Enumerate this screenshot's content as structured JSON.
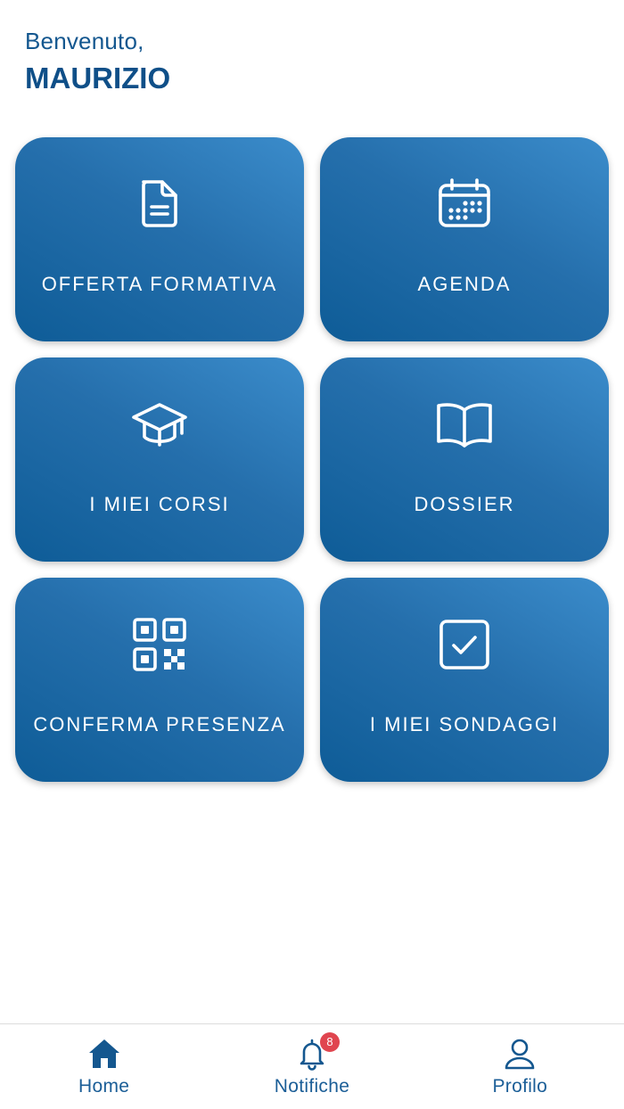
{
  "header": {
    "greeting": "Benvenuto,",
    "user_name": "MAURIZIO"
  },
  "tiles": [
    {
      "label": "OFFERTA FORMATIVA",
      "icon": "document-icon"
    },
    {
      "label": "AGENDA",
      "icon": "calendar-icon"
    },
    {
      "label": "I MIEI CORSI",
      "icon": "graduation-cap-icon"
    },
    {
      "label": "DOSSIER",
      "icon": "open-book-icon"
    },
    {
      "label": "CONFERMA PRESENZA",
      "icon": "qr-code-icon"
    },
    {
      "label": "I MIEI SONDAGGI",
      "icon": "checkbox-icon"
    }
  ],
  "tabbar": {
    "items": [
      {
        "label": "Home",
        "icon": "home-icon",
        "active": true
      },
      {
        "label": "Notifiche",
        "icon": "bell-icon",
        "badge": "8"
      },
      {
        "label": "Profilo",
        "icon": "user-icon"
      }
    ]
  },
  "colors": {
    "primary": "#0f4f88",
    "tile_gradient_light": "#3b8ccb",
    "tile_gradient_dark": "#0e5c97",
    "badge": "#e0454f"
  }
}
